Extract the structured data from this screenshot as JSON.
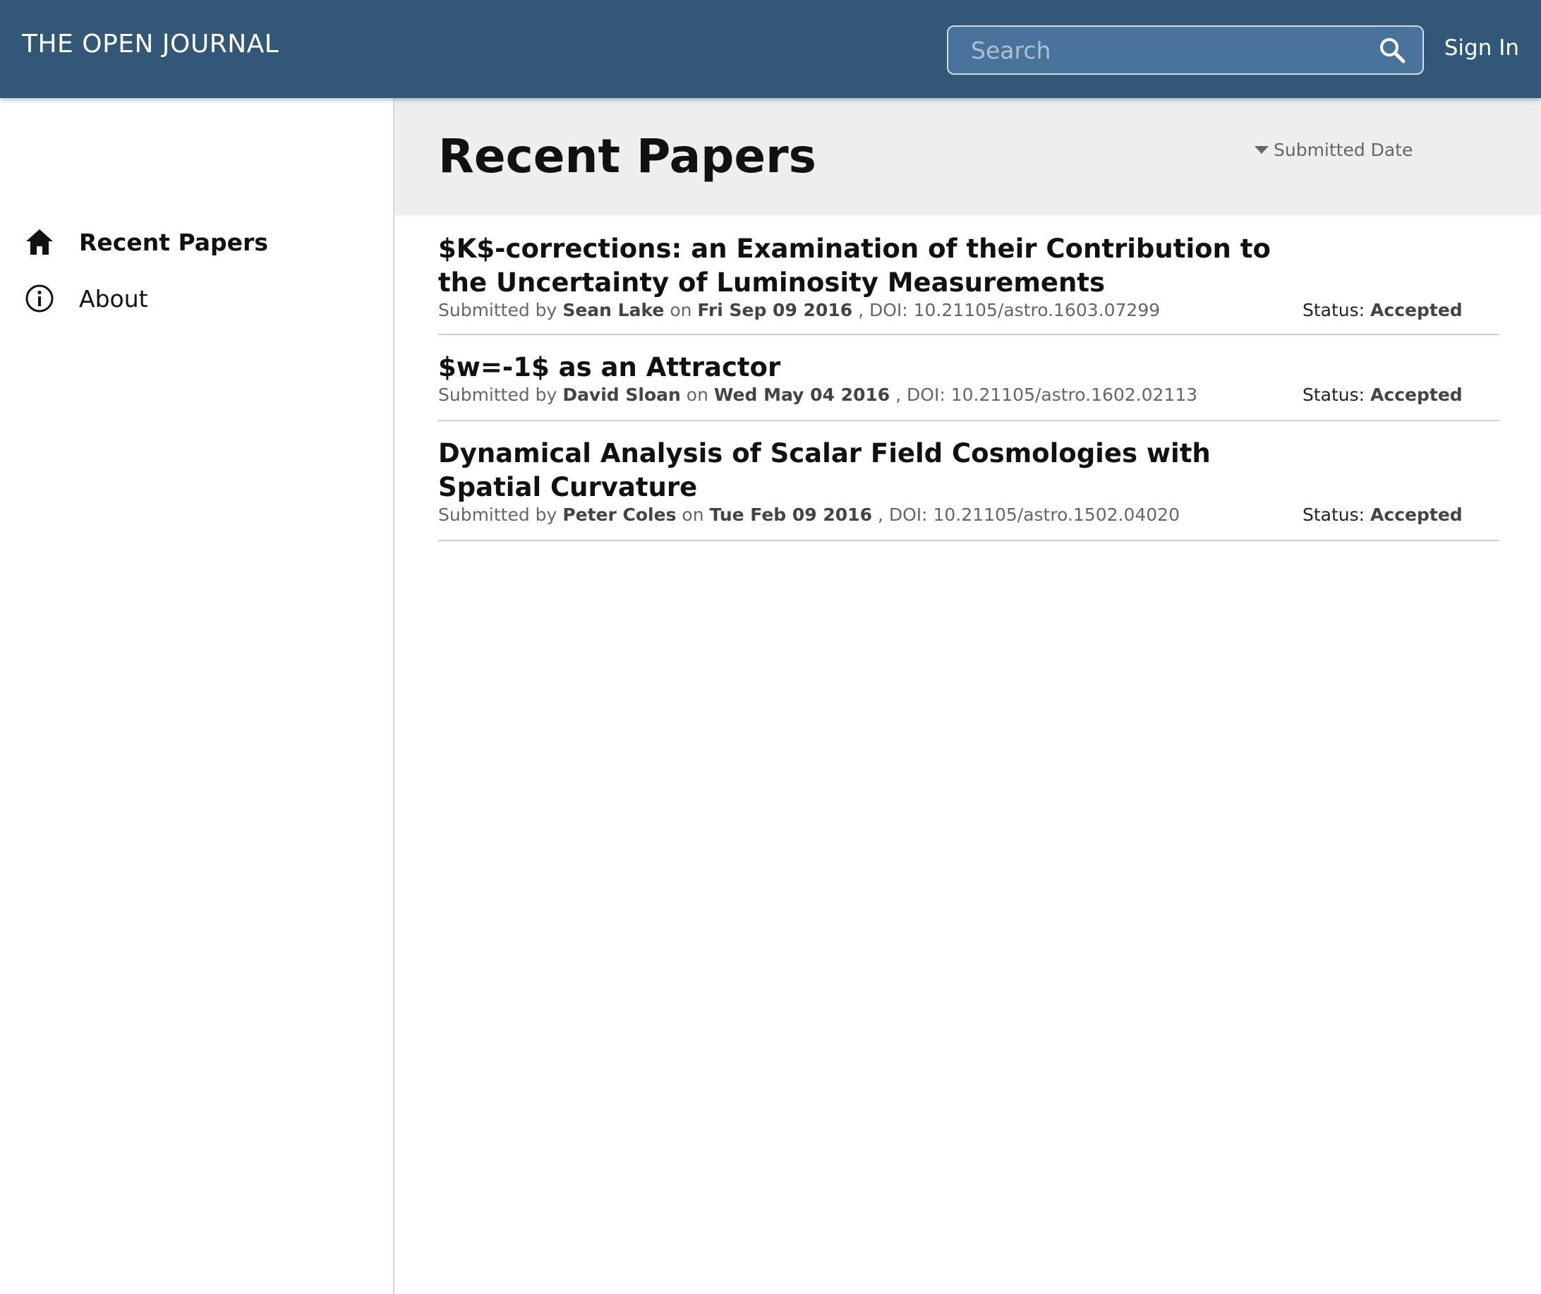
{
  "app": {
    "brand": "THE OPEN JOURNAL"
  },
  "search": {
    "placeholder": "Search",
    "value": ""
  },
  "header": {
    "sign_in_label": "Sign In"
  },
  "sidebar": {
    "items": [
      {
        "label": "Recent Papers",
        "icon": "home-icon",
        "active": true
      },
      {
        "label": "About",
        "icon": "info-icon",
        "active": false
      }
    ]
  },
  "main": {
    "title": "Recent Papers",
    "sort_label": "Submitted Date",
    "papers": [
      {
        "title": "$K$-corrections: an Examination of their Contribution to the Uncertainty of Luminosity Measurements",
        "submitted_by_prefix": "Submitted by",
        "author": "Sean Lake",
        "on_word": "on",
        "date": "Fri Sep 09 2016",
        "doi_text": ", DOI: 10.21105/astro.1603.07299",
        "status_prefix": "Status:",
        "status": "Accepted"
      },
      {
        "title": "$w=-1$ as an Attractor",
        "submitted_by_prefix": "Submitted by",
        "author": "David Sloan",
        "on_word": "on",
        "date": "Wed May 04 2016",
        "doi_text": ", DOI: 10.21105/astro.1602.02113",
        "status_prefix": "Status:",
        "status": "Accepted"
      },
      {
        "title": "Dynamical Analysis of Scalar Field Cosmologies with Spatial Curvature",
        "submitted_by_prefix": "Submitted by",
        "author": "Peter Coles",
        "on_word": "on",
        "date": "Tue Feb 09 2016",
        "doi_text": ", DOI: 10.21105/astro.1502.04020",
        "status_prefix": "Status:",
        "status": "Accepted"
      }
    ]
  },
  "colors": {
    "topbar": "#335777",
    "search_bg": "#4a739c",
    "header_bg": "#eeeeee"
  }
}
